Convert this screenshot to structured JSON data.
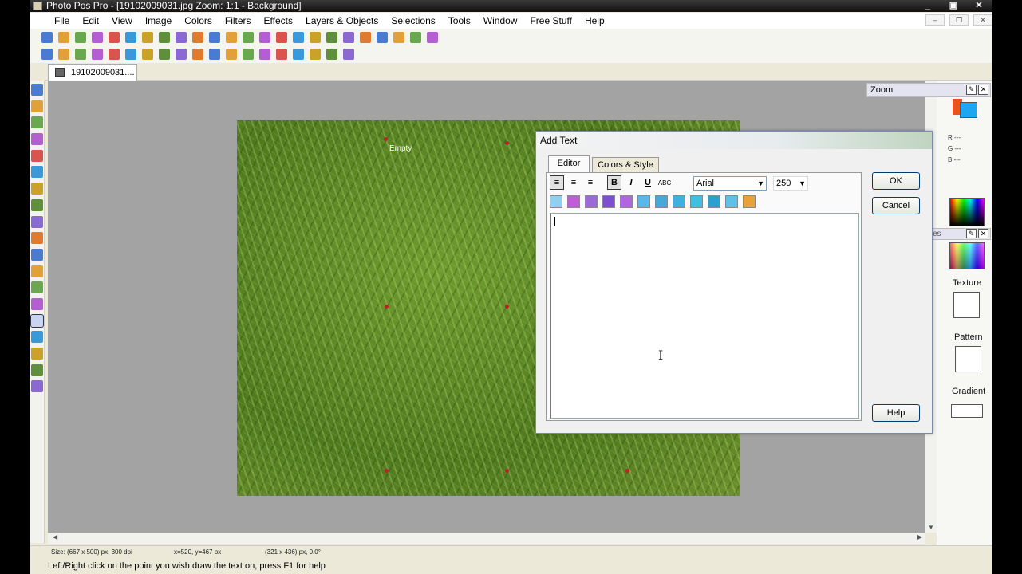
{
  "window": {
    "title": "Photo Pos Pro - [19102009031.jpg  Zoom: 1:1 - Background]",
    "controls": [
      "_",
      "▣",
      "✕"
    ]
  },
  "menu": [
    "File",
    "Edit",
    "View",
    "Image",
    "Colors",
    "Filters",
    "Effects",
    "Layers & Objects",
    "Selections",
    "Tools",
    "Window",
    "Free Stuff",
    "Help"
  ],
  "toolbar1_icons": [
    "new-icon",
    "open-icon",
    "browse-icon",
    "save-icon",
    "save-as-icon",
    "print-icon",
    "scan-icon",
    "undo-icon",
    "redo-icon",
    "cut-icon",
    "copy-icon",
    "paste-icon",
    "paste-new-icon",
    "paste-layer-icon",
    "clipboard-icon",
    "screen-icon",
    "zoom-fit-icon",
    "crop-icon",
    "select-all-icon",
    "transform-icon",
    "layers-icon",
    "rotate-icon",
    "window-icon",
    "pencil-icon"
  ],
  "toolbar2_icons": [
    "rotate-left-icon",
    "rotate-right-icon",
    "flip-h-icon",
    "flip-v-icon",
    "adjust-icon",
    "levels-icon",
    "curves-icon",
    "hue-icon",
    "filter-icon",
    "red-eye-icon",
    "retouch-icon",
    "landscape-icon",
    "color-icon",
    "frame-icon",
    "plant-icon",
    "picture-icon",
    "diamond-icon",
    "wand-icon",
    "star-icon"
  ],
  "document_tab": "19102009031....",
  "left_tools": [
    "move-icon",
    "zoom-icon",
    "rect-select-icon",
    "lasso-icon",
    "magic-wand-icon",
    "clone-icon",
    "pencil-icon",
    "brush-icon",
    "airbrush-icon",
    "smudge-icon",
    "stamp-icon",
    "blur-icon",
    "sharpen-icon",
    "fill-icon",
    "text-tool-icon",
    "shape-icon",
    "dropper-icon",
    "eraser-icon",
    "gradient-icon"
  ],
  "canvas": {
    "photo_label": "Empty"
  },
  "status": {
    "size": "Size: (667 x 500) px, 300 dpi",
    "position": "x=520, y=467 px",
    "selection": "(321 x 436) px, 0.0°",
    "hint": "Left/Right click on the point you wish draw the text on, press F1 for help"
  },
  "panels": {
    "zoom_title": "Zoom",
    "panel2_title": "es",
    "rgb": [
      "R ---",
      "G ---",
      "B ---"
    ],
    "texture_label": "Texture",
    "pattern_label": "Pattern",
    "gradient_label": "Gradient",
    "colors": {
      "foreground": "#e8541a",
      "background": "#1ea6f0"
    }
  },
  "dialog": {
    "title": "Add Text",
    "tabs": [
      "Editor",
      "Colors & Style"
    ],
    "active_tab": "Editor",
    "format_buttons": {
      "align_left": "≡",
      "align_center": "≡",
      "align_right": "≡",
      "bold": "B",
      "italic": "I",
      "underline": "U",
      "strike": "ABC"
    },
    "font": "Arial",
    "size": "250",
    "text_value": "",
    "buttons": {
      "ok": "OK",
      "cancel": "Cancel",
      "help": "Help"
    }
  }
}
